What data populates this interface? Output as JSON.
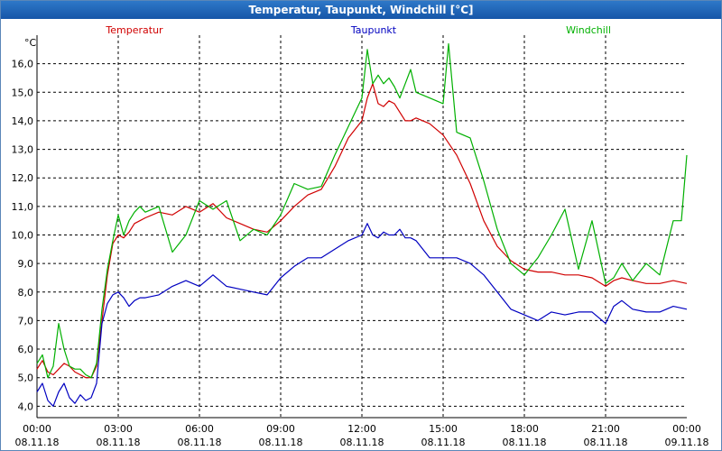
{
  "window": {
    "title": "Temperatur, Taupunkt, Windchill [°C]"
  },
  "chart_data": {
    "type": "line",
    "title": "Temperatur, Taupunkt, Windchill [°C]",
    "ylabel": "°C",
    "xlabel": "",
    "ylim": [
      3.6,
      17.0
    ],
    "xlim": [
      0,
      24
    ],
    "grid": true,
    "legend_placement": "top",
    "yticks": [
      {
        "value": 4.0,
        "label": "4,0"
      },
      {
        "value": 5.0,
        "label": "5,0"
      },
      {
        "value": 6.0,
        "label": "6,0"
      },
      {
        "value": 7.0,
        "label": "7,0"
      },
      {
        "value": 8.0,
        "label": "8,0"
      },
      {
        "value": 9.0,
        "label": "9,0"
      },
      {
        "value": 10.0,
        "label": "10,0"
      },
      {
        "value": 11.0,
        "label": "11,0"
      },
      {
        "value": 12.0,
        "label": "12,0"
      },
      {
        "value": 13.0,
        "label": "13,0"
      },
      {
        "value": 14.0,
        "label": "14,0"
      },
      {
        "value": 15.0,
        "label": "15,0"
      },
      {
        "value": 16.0,
        "label": "16,0"
      }
    ],
    "xticks": [
      {
        "hour": 0,
        "time": "00:00",
        "date": "08.11.18"
      },
      {
        "hour": 3,
        "time": "03:00",
        "date": "08.11.18"
      },
      {
        "hour": 6,
        "time": "06:00",
        "date": "08.11.18"
      },
      {
        "hour": 9,
        "time": "09:00",
        "date": "08.11.18"
      },
      {
        "hour": 12,
        "time": "12:00",
        "date": "08.11.18"
      },
      {
        "hour": 15,
        "time": "15:00",
        "date": "08.11.18"
      },
      {
        "hour": 18,
        "time": "18:00",
        "date": "08.11.18"
      },
      {
        "hour": 21,
        "time": "21:00",
        "date": "08.11.18"
      },
      {
        "hour": 24,
        "time": "00:00",
        "date": "09.11.18"
      }
    ],
    "series": [
      {
        "name": "Temperatur",
        "color": "#d00000",
        "x": [
          0,
          0.2,
          0.4,
          0.6,
          0.8,
          1.0,
          1.2,
          1.4,
          1.6,
          1.8,
          2.0,
          2.2,
          2.4,
          2.6,
          2.8,
          3.0,
          3.2,
          3.4,
          3.6,
          3.8,
          4.0,
          4.5,
          5.0,
          5.5,
          6.0,
          6.5,
          7.0,
          7.5,
          8.0,
          8.5,
          9.0,
          9.5,
          10.0,
          10.5,
          11.0,
          11.5,
          12.0,
          12.2,
          12.4,
          12.6,
          12.8,
          13.0,
          13.2,
          13.4,
          13.6,
          13.8,
          14.0,
          14.5,
          15.0,
          15.5,
          16.0,
          16.5,
          17.0,
          17.5,
          18.0,
          18.5,
          19.0,
          19.5,
          20.0,
          20.5,
          21.0,
          21.3,
          21.6,
          22.0,
          22.5,
          23.0,
          23.5,
          24.0
        ],
        "values": [
          5.3,
          5.6,
          5.2,
          5.1,
          5.3,
          5.5,
          5.4,
          5.2,
          5.1,
          5.0,
          5.0,
          5.4,
          7.0,
          8.6,
          9.7,
          10.0,
          9.9,
          10.1,
          10.4,
          10.5,
          10.6,
          10.8,
          10.7,
          11.0,
          10.8,
          11.1,
          10.6,
          10.4,
          10.2,
          10.1,
          10.5,
          11.0,
          11.4,
          11.6,
          12.4,
          13.4,
          14.0,
          14.8,
          15.3,
          14.6,
          14.5,
          14.7,
          14.6,
          14.3,
          14.0,
          14.0,
          14.1,
          13.9,
          13.5,
          12.8,
          11.8,
          10.5,
          9.6,
          9.1,
          8.8,
          8.7,
          8.7,
          8.6,
          8.6,
          8.5,
          8.2,
          8.4,
          8.5,
          8.4,
          8.3,
          8.3,
          8.4,
          8.3
        ]
      },
      {
        "name": "Taupunkt",
        "color": "#0000c0",
        "x": [
          0,
          0.2,
          0.4,
          0.6,
          0.8,
          1.0,
          1.2,
          1.4,
          1.6,
          1.8,
          2.0,
          2.2,
          2.4,
          2.6,
          2.8,
          3.0,
          3.2,
          3.4,
          3.6,
          3.8,
          4.0,
          4.5,
          5.0,
          5.5,
          6.0,
          6.5,
          7.0,
          7.5,
          8.0,
          8.5,
          9.0,
          9.5,
          10.0,
          10.5,
          11.0,
          11.5,
          12.0,
          12.2,
          12.4,
          12.6,
          12.8,
          13.0,
          13.2,
          13.4,
          13.6,
          13.8,
          14.0,
          14.5,
          15.0,
          15.5,
          16.0,
          16.5,
          17.0,
          17.5,
          18.0,
          18.5,
          19.0,
          19.5,
          20.0,
          20.5,
          21.0,
          21.3,
          21.6,
          22.0,
          22.5,
          23.0,
          23.5,
          24.0
        ],
        "values": [
          4.5,
          4.8,
          4.2,
          4.0,
          4.5,
          4.8,
          4.3,
          4.1,
          4.4,
          4.2,
          4.3,
          4.8,
          6.9,
          7.6,
          7.9,
          8.0,
          7.8,
          7.5,
          7.7,
          7.8,
          7.8,
          7.9,
          8.2,
          8.4,
          8.2,
          8.6,
          8.2,
          8.1,
          8.0,
          7.9,
          8.5,
          8.9,
          9.2,
          9.2,
          9.5,
          9.8,
          10.0,
          10.4,
          10.0,
          9.9,
          10.1,
          10.0,
          10.0,
          10.2,
          9.9,
          9.9,
          9.8,
          9.2,
          9.2,
          9.2,
          9.0,
          8.6,
          8.0,
          7.4,
          7.2,
          7.0,
          7.3,
          7.2,
          7.3,
          7.3,
          6.9,
          7.5,
          7.7,
          7.4,
          7.3,
          7.3,
          7.5,
          7.4
        ]
      },
      {
        "name": "Windchill",
        "color": "#00b000",
        "x": [
          0,
          0.2,
          0.4,
          0.6,
          0.8,
          1.0,
          1.2,
          1.4,
          1.6,
          1.8,
          2.0,
          2.2,
          2.4,
          2.6,
          2.8,
          3.0,
          3.2,
          3.4,
          3.6,
          3.8,
          4.0,
          4.5,
          5.0,
          5.5,
          6.0,
          6.5,
          7.0,
          7.5,
          8.0,
          8.5,
          9.0,
          9.5,
          10.0,
          10.5,
          11.0,
          11.5,
          12.0,
          12.2,
          12.4,
          12.6,
          12.8,
          13.0,
          13.2,
          13.4,
          13.6,
          13.8,
          14.0,
          14.5,
          15.0,
          15.2,
          15.5,
          16.0,
          16.5,
          17.0,
          17.5,
          18.0,
          18.5,
          19.0,
          19.5,
          20.0,
          20.5,
          21.0,
          21.3,
          21.6,
          22.0,
          22.5,
          23.0,
          23.5,
          23.8,
          24.0
        ],
        "values": [
          5.5,
          5.8,
          5.0,
          5.4,
          6.9,
          6.0,
          5.4,
          5.3,
          5.3,
          5.1,
          5.0,
          5.5,
          7.4,
          8.8,
          9.8,
          10.7,
          10.0,
          10.5,
          10.8,
          11.0,
          10.8,
          11.0,
          9.4,
          10.0,
          11.2,
          10.9,
          11.2,
          9.8,
          10.2,
          10.0,
          10.7,
          11.8,
          11.6,
          11.7,
          12.8,
          13.8,
          14.8,
          16.5,
          15.3,
          15.6,
          15.3,
          15.5,
          15.2,
          14.8,
          15.3,
          15.8,
          15.0,
          14.8,
          14.6,
          16.7,
          13.6,
          13.4,
          11.9,
          10.2,
          9.0,
          8.6,
          9.2,
          10.0,
          10.9,
          8.8,
          10.5,
          8.3,
          8.5,
          9.0,
          8.4,
          9.0,
          8.6,
          10.5,
          10.5,
          12.8
        ]
      }
    ]
  }
}
